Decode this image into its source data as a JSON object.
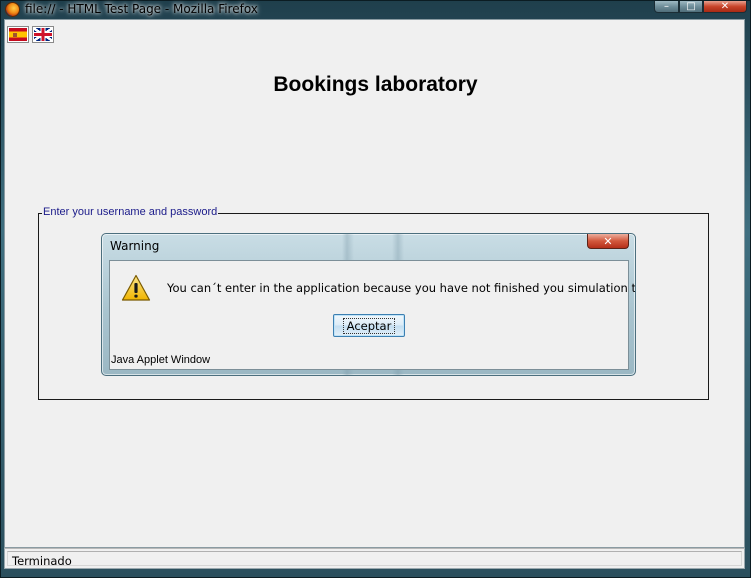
{
  "window": {
    "title": "file:// - HTML Test Page - Mozilla Firefox",
    "minimize_glyph": "–",
    "maximize_glyph": "□",
    "close_glyph": "✕"
  },
  "page": {
    "languages": [
      {
        "code": "es",
        "icon": "spain-flag-icon"
      },
      {
        "code": "en",
        "icon": "uk-flag-icon"
      }
    ],
    "heading": "Bookings laboratory",
    "login_legend": "Enter your username and password"
  },
  "dialog": {
    "title": "Warning",
    "close_glyph": "✕",
    "icon": "warning-icon",
    "message": "You can´t enter in the application because you have not finished you simulation tasks.",
    "ok_label": "Aceptar",
    "applet_label": "Java Applet Window"
  },
  "statusbar": {
    "text": "Terminado"
  },
  "colors": {
    "legend_text": "#1b1b8a",
    "warning_yellow": "#f4c430",
    "close_red": "#c8442a"
  }
}
